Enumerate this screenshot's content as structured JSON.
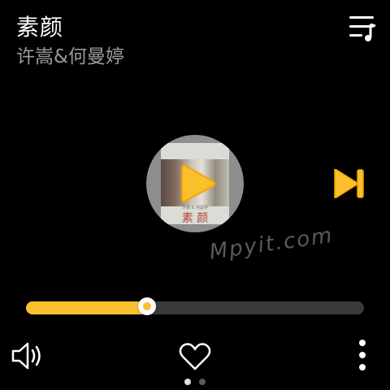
{
  "song": {
    "title": "素颜",
    "artist": "许嵩&何曼婷"
  },
  "album": {
    "caption": "素 颜",
    "sub_caption": "许嵩 & 何曼婷"
  },
  "watermark": "Mpyit.com",
  "progress": {
    "fraction": 0.34
  },
  "pager": {
    "pages": 2,
    "current": 1
  },
  "icons": {
    "playlist": "playlist-music-icon",
    "play": "play-icon",
    "next": "skip-next-icon",
    "volume": "volume-icon",
    "heart": "heart-outline-icon",
    "more": "more-vertical-icon"
  },
  "colors": {
    "accent": "#fbc02d",
    "background": "#000000",
    "text_primary": "#ffffff",
    "text_secondary": "#9a9a9a"
  }
}
